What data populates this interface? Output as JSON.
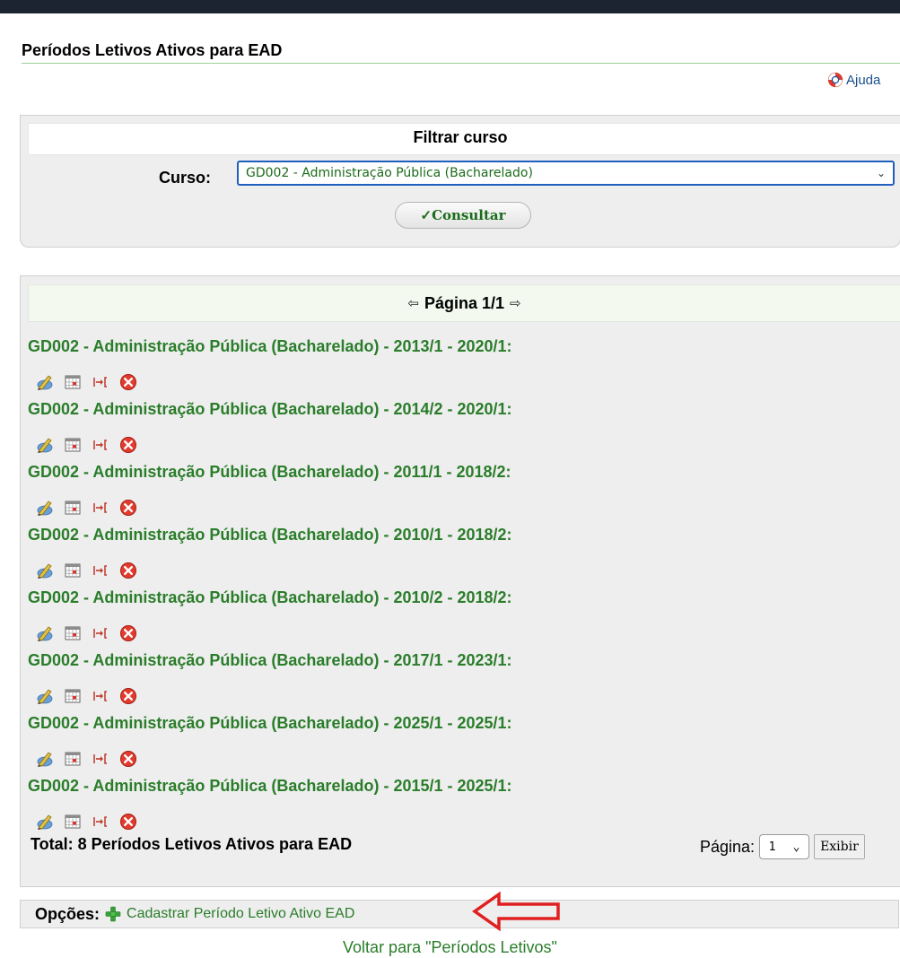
{
  "header": {
    "title": "Períodos Letivos Ativos para EAD",
    "help_label": "Ajuda"
  },
  "filter": {
    "title": "Filtrar curso",
    "curso_label": "Curso:",
    "curso_value": "GD002 - Administração Pública (Bacharelado)",
    "submit_label": "Consultar"
  },
  "list": {
    "pager_label": "Página 1/1",
    "rows": [
      {
        "title": "GD002 - Administração Pública (Bacharelado) - 2013/1 - 2020/1:"
      },
      {
        "title": "GD002 - Administração Pública (Bacharelado) - 2014/2 - 2020/1:"
      },
      {
        "title": "GD002 - Administração Pública (Bacharelado) - 2011/1 - 2018/2:"
      },
      {
        "title": "GD002 - Administração Pública (Bacharelado) - 2010/1 - 2018/2:"
      },
      {
        "title": "GD002 - Administração Pública (Bacharelado) - 2010/2 - 2018/2:"
      },
      {
        "title": "GD002 - Administração Pública (Bacharelado) - 2017/1 - 2023/1:"
      },
      {
        "title": "GD002 - Administração Pública (Bacharelado) - 2025/1 - 2025/1:"
      },
      {
        "title": "GD002 - Administração Pública (Bacharelado) - 2015/1 - 2025/1:"
      }
    ],
    "row_icons": [
      "edit-icon",
      "calendar-icon",
      "move-icon",
      "delete-icon"
    ],
    "total_label": "Total: 8 Períodos Letivos Ativos para EAD",
    "page_label": "Página:",
    "page_value": "1",
    "show_button": "Exibir"
  },
  "options": {
    "label": "Opções:",
    "add_link": "Cadastrar Período Letivo Ativo EAD"
  },
  "footer": {
    "back_link": "Voltar para \"Períodos Letivos\""
  },
  "colors": {
    "link_green": "#2a7d2a",
    "top_bar": "#1c2331",
    "callout_red": "#e02020"
  }
}
